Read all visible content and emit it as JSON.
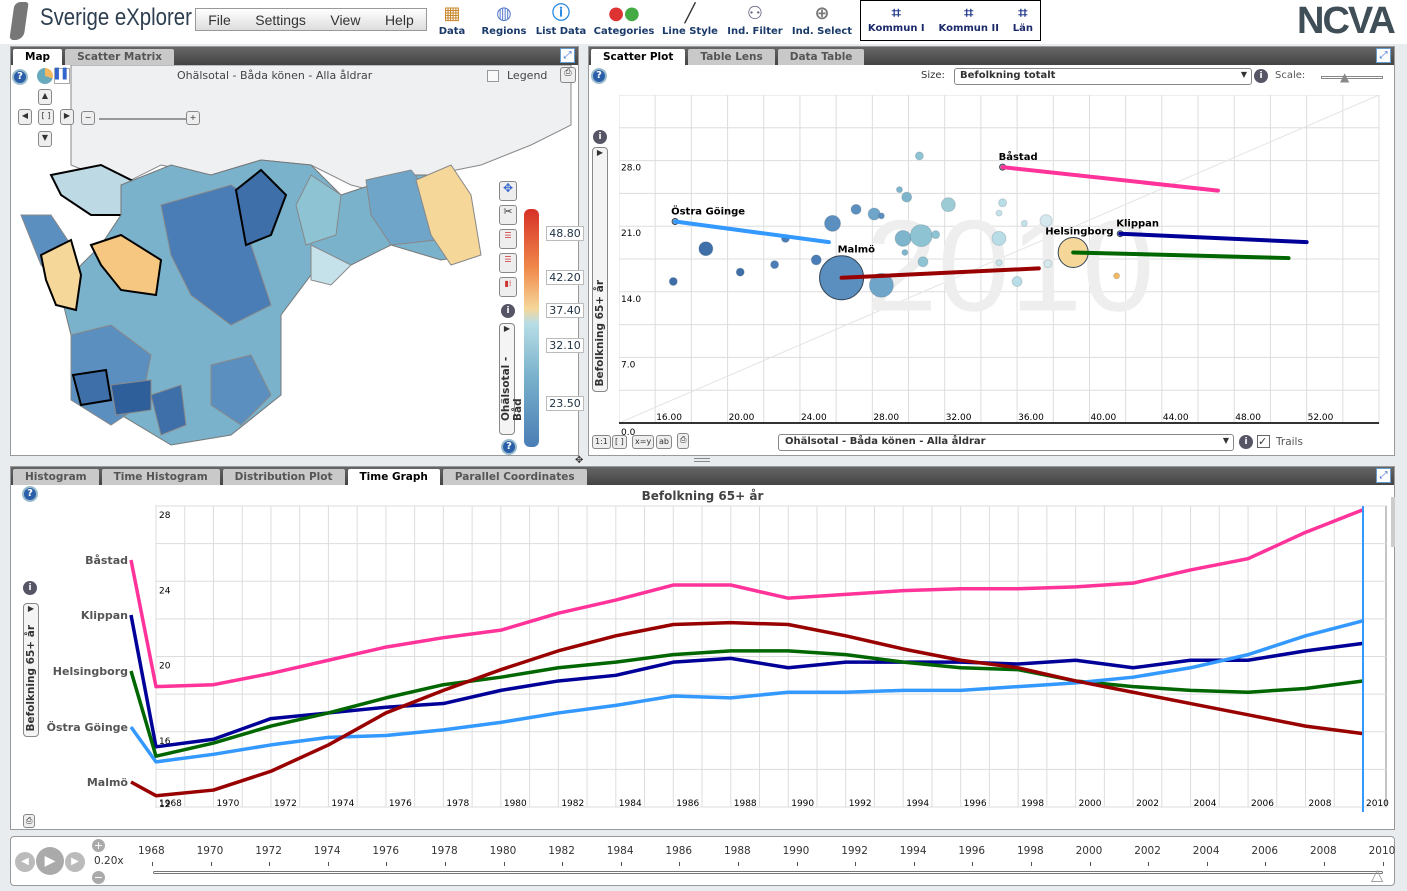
{
  "header": {
    "title": "Sverige eXplorer",
    "menu": [
      "File",
      "Settings",
      "View",
      "Help"
    ],
    "tools": [
      {
        "label": "Data",
        "icon": "box-icon"
      },
      {
        "label": "Regions",
        "icon": "globe-icon"
      },
      {
        "label": "List Data",
        "icon": "info-icon"
      },
      {
        "label": "Categories",
        "icon": "categories-icon"
      },
      {
        "label": "Line Style",
        "icon": "line-style-icon"
      },
      {
        "label": "Ind. Filter",
        "icon": "filter-icon"
      },
      {
        "label": "Ind. Select",
        "icon": "plus-circle-icon"
      }
    ],
    "regions": [
      "Kommun I",
      "Kommun II",
      "Län"
    ],
    "logo": "NCVA"
  },
  "map_panel": {
    "tabs": [
      "Map",
      "Scatter Matrix"
    ],
    "active_tab": "Map",
    "title": "Ohälsotal - Båda könen - Alla åldrar",
    "legend_label": "Legend",
    "axis_label": "Ohälsotal - Båd",
    "color_legend": [
      "48.80",
      "42.20",
      "37.40",
      "32.10",
      "23.50"
    ],
    "colors": {
      "low": "#4a7db5",
      "mid": "#b8dde6",
      "high": "#f5d79a",
      "max": "#d73027"
    }
  },
  "scatter_panel": {
    "tabs": [
      "Scatter Plot",
      "Table Lens",
      "Data Table"
    ],
    "active_tab": "Scatter Plot",
    "size_label": "Size:",
    "size_value": "Befolkning totalt",
    "scale_label": "Scale:",
    "x_select": "Ohälsotal - Båda könen - Alla åldrar",
    "trails_label": "Trails",
    "trails_checked": true,
    "buttons": [
      "1:1",
      "[ ]",
      "x=y",
      "ab"
    ]
  },
  "bottom_panel": {
    "tabs": [
      "Histogram",
      "Time Histogram",
      "Distribution Plot",
      "Time Graph",
      "Parallel Coordinates"
    ],
    "active_tab": "Time Graph"
  },
  "time_slider": {
    "speed": "0.20x",
    "years": [
      "1968",
      "1970",
      "1972",
      "1974",
      "1976",
      "1978",
      "1980",
      "1982",
      "1984",
      "1986",
      "1988",
      "1990",
      "1992",
      "1994",
      "1996",
      "1998",
      "2000",
      "2002",
      "2004",
      "2006",
      "2008",
      "2010"
    ],
    "current": "2010"
  },
  "chart_data": [
    {
      "type": "scatter",
      "watermark": "2010",
      "xlabel": "Ohälsotal - Båda könen - Alla åldrar",
      "ylabel": "Befolkning 65+ år",
      "xticks": [
        "16.00",
        "20.00",
        "24.00",
        "28.00",
        "32.00",
        "36.00",
        "40.00",
        "44.00",
        "48.00",
        "52.00"
      ],
      "yticks": [
        "0.0",
        "7.0",
        "14.0",
        "21.0",
        "28.0"
      ],
      "xlim": [
        14,
        56
      ],
      "ylim": [
        0,
        35
      ],
      "grid": true,
      "labeled": [
        {
          "name": "Östra Göinge",
          "x": 17.1,
          "y": 21.5,
          "size": 3,
          "color": "#3399ff",
          "trail_end": [
            25.6,
            19.3
          ]
        },
        {
          "name": "Båstad",
          "x": 35.2,
          "y": 27.3,
          "size": 3,
          "color": "#ff3399",
          "trail_end": [
            47.1,
            24.8
          ]
        },
        {
          "name": "Malmö",
          "x": 26.3,
          "y": 15.5,
          "size": 22,
          "color": "#990000",
          "fill": "#5b8fc0",
          "trail_end": [
            37.2,
            16.5
          ]
        },
        {
          "name": "Helsingborg",
          "x": 39.1,
          "y": 18.2,
          "size": 15,
          "color": "#006600",
          "fill": "#f5d79a",
          "trail_end": [
            51,
            17.6
          ]
        },
        {
          "name": "Klippan",
          "x": 41.7,
          "y": 20.2,
          "size": 3,
          "color": "#000099",
          "trail_end": [
            52,
            19.3
          ]
        }
      ],
      "points": [
        [
          30.6,
          28.5,
          4,
          "#8ec3d3"
        ],
        [
          29.9,
          24.1,
          5,
          "#7fb5cc"
        ],
        [
          29.5,
          24.9,
          3,
          "#7fb5cc"
        ],
        [
          32.2,
          23.3,
          7,
          "#9ccbd6"
        ],
        [
          28.1,
          22.3,
          6,
          "#6fa5c8"
        ],
        [
          27.1,
          22.8,
          5,
          "#5b8fc0"
        ],
        [
          28.5,
          22.1,
          3,
          "#5b8fc0"
        ],
        [
          25.8,
          21.3,
          8,
          "#5b8fc0"
        ],
        [
          35.2,
          23.5,
          4,
          "#b8dde6"
        ],
        [
          35.0,
          22.4,
          3,
          "#c5e2ea"
        ],
        [
          36.4,
          21.3,
          3,
          "#c5e2ea"
        ],
        [
          37.6,
          21.6,
          6,
          "#d5e8ee"
        ],
        [
          29.7,
          19.7,
          8,
          "#7fb5cc"
        ],
        [
          30.7,
          20.0,
          11,
          "#8ec3d3"
        ],
        [
          31.5,
          20.1,
          4,
          "#8ec3d3"
        ],
        [
          35.0,
          19.7,
          7,
          "#b8dde6"
        ],
        [
          29.8,
          18.2,
          3,
          "#7fb5cc"
        ],
        [
          30.8,
          17.2,
          5,
          "#8ec3d3"
        ],
        [
          35.0,
          17.1,
          3,
          "#c5e2ea"
        ],
        [
          37.7,
          17.0,
          4,
          "#d5e8ee"
        ],
        [
          36.0,
          15.1,
          5,
          "#b8dde6"
        ],
        [
          28.5,
          14.7,
          12,
          "#6fa5c8"
        ],
        [
          18.8,
          18.6,
          7,
          "#3f6fa8"
        ],
        [
          24.9,
          17.4,
          5,
          "#4a7db5"
        ],
        [
          22.6,
          16.9,
          4,
          "#4a7db5"
        ],
        [
          20.7,
          16.1,
          4,
          "#3f6fa8"
        ],
        [
          17.0,
          15.1,
          4,
          "#3f6fa8"
        ],
        [
          23.2,
          19.7,
          4,
          "#4a7db5"
        ],
        [
          41.5,
          15.7,
          3,
          "#f4b860"
        ]
      ]
    },
    {
      "type": "line",
      "title": "Befolkning 65+ år",
      "ylabel": "Befolkning 65+ år",
      "ylim": [
        12,
        28
      ],
      "yticks": [
        "12",
        "16",
        "20",
        "24",
        "28"
      ],
      "xlim": [
        1968,
        2010
      ],
      "grid": true,
      "x": [
        1968,
        1970,
        1972,
        1974,
        1976,
        1978,
        1980,
        1982,
        1984,
        1986,
        1988,
        1990,
        1992,
        1994,
        1996,
        1998,
        2000,
        2002,
        2004,
        2006,
        2008,
        2010
      ],
      "series": [
        {
          "name": "Båstad",
          "color": "#ff3399",
          "values": [
            18.4,
            18.5,
            19.1,
            19.8,
            20.5,
            21.0,
            21.4,
            22.3,
            23.0,
            23.8,
            23.8,
            23.1,
            23.3,
            23.5,
            23.6,
            23.6,
            23.7,
            23.9,
            24.6,
            25.2,
            26.6,
            27.8
          ]
        },
        {
          "name": "Klippan",
          "color": "#000099",
          "values": [
            15.2,
            15.6,
            16.7,
            17.0,
            17.3,
            17.5,
            18.2,
            18.7,
            19.0,
            19.7,
            19.9,
            19.4,
            19.7,
            19.7,
            19.7,
            19.6,
            19.8,
            19.4,
            19.8,
            19.8,
            20.3,
            20.7
          ]
        },
        {
          "name": "Helsingborg",
          "color": "#006600",
          "values": [
            14.7,
            15.4,
            16.3,
            17.0,
            17.8,
            18.5,
            18.9,
            19.4,
            19.7,
            20.1,
            20.3,
            20.3,
            20.1,
            19.7,
            19.4,
            19.3,
            18.7,
            18.4,
            18.2,
            18.1,
            18.3,
            18.7
          ]
        },
        {
          "name": "Östra Göinge",
          "color": "#3399ff",
          "values": [
            14.4,
            14.8,
            15.3,
            15.7,
            15.8,
            16.1,
            16.5,
            17.0,
            17.4,
            17.9,
            17.8,
            18.1,
            18.1,
            18.2,
            18.2,
            18.4,
            18.6,
            18.9,
            19.4,
            20.1,
            21.1,
            21.9
          ]
        },
        {
          "name": "Malmö",
          "color": "#990000",
          "values": [
            12.6,
            12.9,
            13.9,
            15.3,
            17.0,
            18.2,
            19.3,
            20.3,
            21.1,
            21.7,
            21.8,
            21.7,
            21.1,
            20.4,
            19.8,
            19.4,
            18.7,
            18.1,
            17.5,
            16.9,
            16.3,
            15.9
          ]
        }
      ]
    }
  ]
}
